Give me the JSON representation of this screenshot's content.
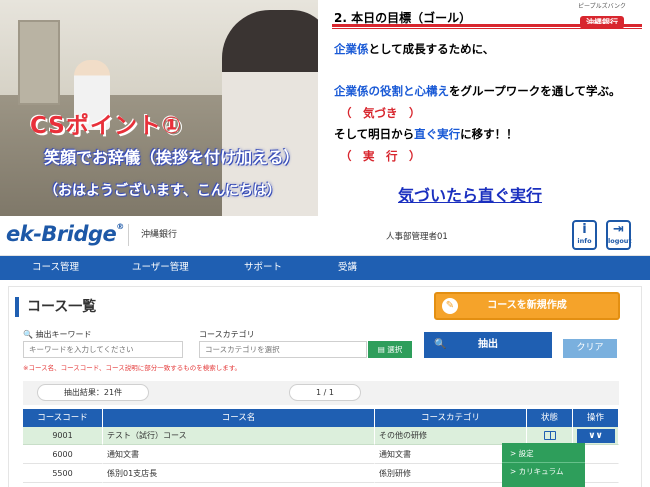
{
  "video": {
    "title": "CSポイント①",
    "line1": "笑顔でお辞儀（挨拶を付け加える）",
    "line2": "（おはようございます、こんにちは）"
  },
  "slide": {
    "title": "2. 本日の目標（ゴール）",
    "bank_sub": "ピープルズバンク",
    "bank_name": "沖縄銀行",
    "l1_blue": "企業係",
    "l1_rest": "として成長するために、",
    "l2_blue": "企業係の役割と心構え",
    "l2_rest": "をグループワークを通して学ぶ。",
    "l3": "（　気づき　）",
    "l4_a": "そして明日から",
    "l4_blue": "直ぐ実行",
    "l4_b": "に移す！！",
    "l5": "（　実　行　）",
    "tagline": "気づいたら直ぐ実行"
  },
  "header": {
    "logo": "ek-Bridge",
    "logo_mark": "®",
    "org": "沖縄銀行",
    "user": "人事部管理者01",
    "info_label": "info",
    "logout_label": "logout"
  },
  "nav": [
    "コース管理",
    "ユーザー管理",
    "サポート",
    "受講"
  ],
  "page": {
    "title": "コース一覧",
    "new_button": "コースを新規作成",
    "keyword_label": "抽出キーワード",
    "keyword_placeholder": "キーワードを入力してください",
    "category_label": "コースカテゴリ",
    "category_placeholder": "コースカテゴリを選択",
    "select_button": "選択",
    "search_button": "抽出",
    "clear_button": "クリア",
    "note": "※コース名、コースコード、コース説明に部分一致するものを検索します。",
    "result": "抽出結果：21件",
    "pagination": "1 / 1"
  },
  "table": {
    "headers": [
      "コースコード",
      "コース名",
      "コースカテゴリ",
      "状態",
      "操作"
    ],
    "rows": [
      {
        "code": "9001",
        "name": "テスト（試行）コース",
        "category": "その他の研修",
        "op": "∨∨"
      },
      {
        "code": "6000",
        "name": "通知文書",
        "category": "通知文書",
        "op": ""
      },
      {
        "code": "5500",
        "name": "係別01支店長",
        "category": "係別研修",
        "op": ""
      }
    ]
  },
  "dropdown": [
    "> 設定",
    "> カリキュラム"
  ],
  "colors": {
    "brand_blue": "#1f5fb2",
    "accent_orange": "#f5a32a",
    "green": "#2e9e5b",
    "red": "#d8262e"
  }
}
